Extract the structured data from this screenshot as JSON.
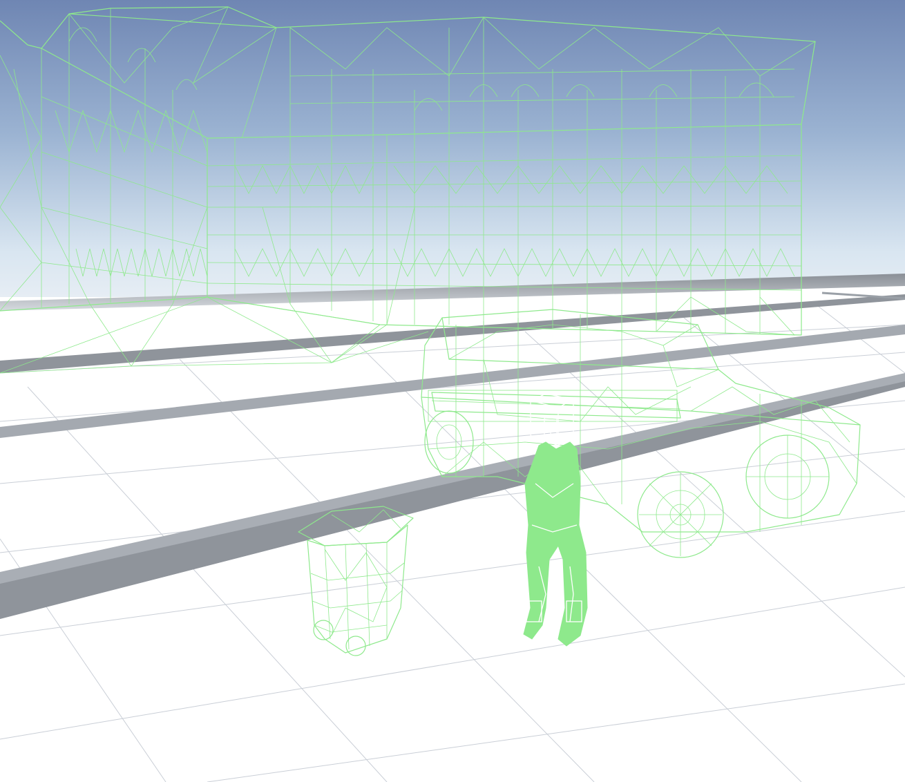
{
  "scene": {
    "view_mode": "wireframe",
    "objects": [
      {
        "id": "building",
        "kind": "building facade"
      },
      {
        "id": "vehicle",
        "kind": "suv"
      },
      {
        "id": "character",
        "kind": "humanoid figure"
      },
      {
        "id": "trash-bin",
        "kind": "wheelie bin"
      },
      {
        "id": "road",
        "kind": "road with curbs"
      },
      {
        "id": "ground",
        "kind": "grid ground plane"
      }
    ]
  },
  "colors": {
    "wireframe": "#8ee98c",
    "sky_top": "#6f86b3",
    "sky_horizon": "#ddeaf3",
    "ground": "#ffffff",
    "grid": "#c9ced6",
    "road_curb": "#8f949b"
  }
}
